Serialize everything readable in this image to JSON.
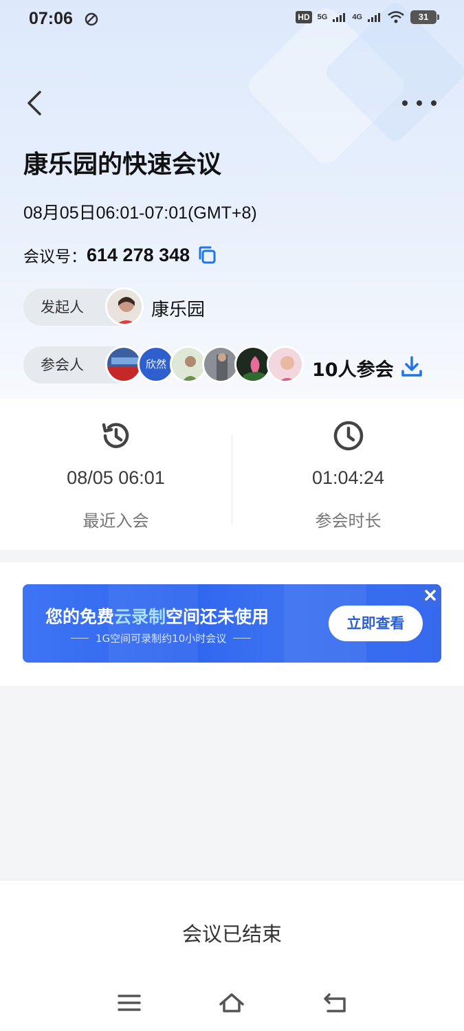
{
  "status_bar": {
    "time": "07:06",
    "hd": "HD",
    "net1": "5G",
    "net2": "4G",
    "battery": "31"
  },
  "meeting": {
    "title": "康乐园的快速会议",
    "time_range": "08月05日06:01-07:01(GMT+8)",
    "id_label": "会议号：",
    "id_value": "614 278 348",
    "host_label": "发起人",
    "host_name": "康乐园",
    "participants_label": "参会人",
    "participant_avatar_text": "欣然",
    "participant_count": "10人参会"
  },
  "stats": {
    "recent_join_value": "08/05 06:01",
    "recent_join_label": "最近入会",
    "duration_value": "01:04:24",
    "duration_label": "参会时长"
  },
  "promo": {
    "heading_prefix": "您的免费",
    "heading_highlight": "云录制",
    "heading_suffix": "空间还未使用",
    "subtext": "1G空间可录制约10小时会议",
    "cta": "立即查看"
  },
  "footer": {
    "status": "会议已结束"
  },
  "colors": {
    "accent": "#1f74e6",
    "promo_bg": "#3669ef"
  }
}
